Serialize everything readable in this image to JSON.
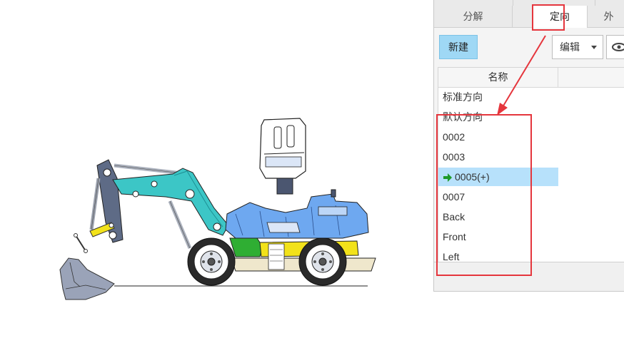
{
  "tabs": [
    {
      "label": "分解",
      "active": false
    },
    {
      "label": "定向",
      "active": true
    },
    {
      "label": "外",
      "active": false
    }
  ],
  "toolbar": {
    "new_label": "新建",
    "edit_label": "编辑"
  },
  "list": {
    "column_header": "名称",
    "items": [
      {
        "label": "标准方向",
        "selected": false
      },
      {
        "label": "默认方向",
        "selected": false
      },
      {
        "label": "0002",
        "selected": false
      },
      {
        "label": "0003",
        "selected": false
      },
      {
        "label": "0005(+)",
        "selected": true,
        "icon": "green-arrow-icon"
      },
      {
        "label": "0007",
        "selected": false
      },
      {
        "label": "Back",
        "selected": false
      },
      {
        "label": "Front",
        "selected": false
      },
      {
        "label": "Left",
        "selected": false
      }
    ]
  },
  "colors": {
    "highlight": "#e5363d",
    "selection": "#b7e1fb",
    "new_button": "#9fd8f5",
    "boom": "#3cc6c6",
    "cabin": "#6ea8f0",
    "chassis_yellow": "#f2e21a",
    "chassis_green": "#2fae33"
  }
}
